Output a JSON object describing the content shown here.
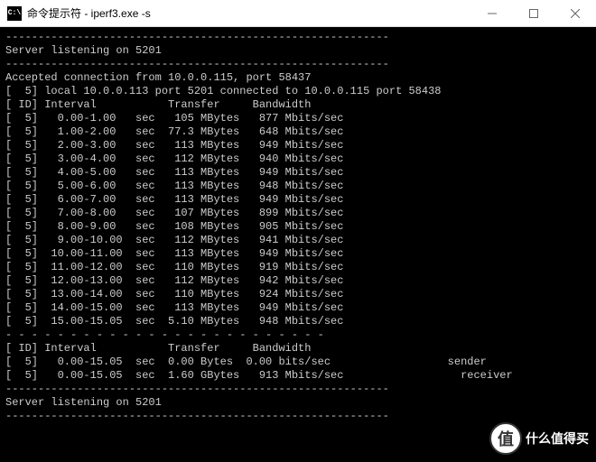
{
  "window": {
    "title": "命令提示符 - iperf3.exe  -s",
    "icon_label": "C:\\"
  },
  "terminal": {
    "dashes": "-----------------------------------------------------------",
    "listening": "Server listening on 5201",
    "accepted": "Accepted connection from 10.0.0.115, port 58437",
    "local": "[  5] local 10.0.0.113 port 5201 connected to 10.0.0.115 port 58438",
    "header": "[ ID] Interval           Transfer     Bandwidth",
    "rows": [
      "[  5]   0.00-1.00   sec   105 MBytes   877 Mbits/sec",
      "[  5]   1.00-2.00   sec  77.3 MBytes   648 Mbits/sec",
      "[  5]   2.00-3.00   sec   113 MBytes   949 Mbits/sec",
      "[  5]   3.00-4.00   sec   112 MBytes   940 Mbits/sec",
      "[  5]   4.00-5.00   sec   113 MBytes   949 Mbits/sec",
      "[  5]   5.00-6.00   sec   113 MBytes   948 Mbits/sec",
      "[  5]   6.00-7.00   sec   113 MBytes   949 Mbits/sec",
      "[  5]   7.00-8.00   sec   107 MBytes   899 Mbits/sec",
      "[  5]   8.00-9.00   sec   108 MBytes   905 Mbits/sec",
      "[  5]   9.00-10.00  sec   112 MBytes   941 Mbits/sec",
      "[  5]  10.00-11.00  sec   113 MBytes   949 Mbits/sec",
      "[  5]  11.00-12.00  sec   110 MBytes   919 Mbits/sec",
      "[  5]  12.00-13.00  sec   112 MBytes   942 Mbits/sec",
      "[  5]  13.00-14.00  sec   110 MBytes   924 Mbits/sec",
      "[  5]  14.00-15.00  sec   113 MBytes   949 Mbits/sec",
      "[  5]  15.00-15.05  sec  5.10 MBytes   948 Mbits/sec"
    ],
    "sep": "- - - - - - - - - - - - - - - - - - - - - - - - -",
    "summary_header": "[ ID] Interval           Transfer     Bandwidth",
    "summary_rows": [
      "[  5]   0.00-15.05  sec  0.00 Bytes  0.00 bits/sec                  sender",
      "[  5]   0.00-15.05  sec  1.60 GBytes   913 Mbits/sec                  receiver"
    ],
    "listening2": "Server listening on 5201"
  },
  "watermark": {
    "circle": "值",
    "text": "什么值得买"
  }
}
